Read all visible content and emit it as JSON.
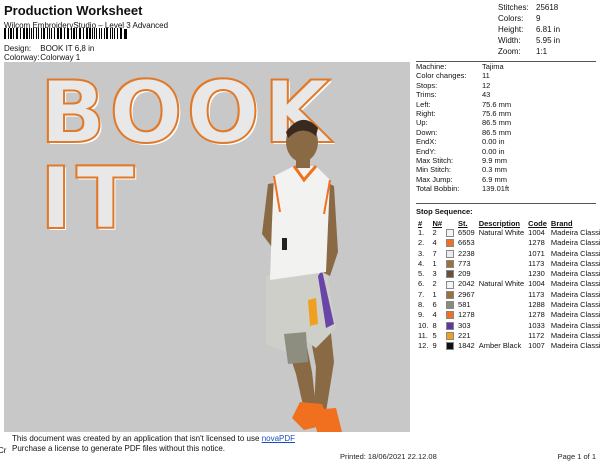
{
  "header": {
    "title": "Production Worksheet",
    "software": "Wilcom EmbroideryStudio – Level 3 Advanced",
    "design_label": "Design:",
    "design_value": "BOOK IT 6,8 in",
    "colorway_label": "Colorway:",
    "colorway_value": "Colorway 1"
  },
  "stats": [
    {
      "label": "Stitches:",
      "value": "25618"
    },
    {
      "label": "Colors:",
      "value": "9"
    },
    {
      "label": "Height:",
      "value": "6.81 in"
    },
    {
      "label": "Width:",
      "value": "5.95 in"
    },
    {
      "label": "Zoom:",
      "value": "1:1"
    }
  ],
  "design": {
    "text": "BOOK IT",
    "colors": {
      "bg": "#c8c8c8",
      "outline": "#e07a2a",
      "letter": "#e8e8e8"
    }
  },
  "machine_info": [
    {
      "label": "Machine:",
      "value": "Tajima"
    },
    {
      "label": "Color changes:",
      "value": "11"
    },
    {
      "label": "Stops:",
      "value": "12"
    },
    {
      "label": "Trims:",
      "value": "43"
    },
    {
      "label": "Left:",
      "value": "75.6 mm"
    },
    {
      "label": "Right:",
      "value": "75.6 mm"
    },
    {
      "label": "Up:",
      "value": "86.5 mm"
    },
    {
      "label": "Down:",
      "value": "86.5 mm"
    },
    {
      "label": "EndX:",
      "value": "0.00 in"
    },
    {
      "label": "EndY:",
      "value": "0.00 in"
    },
    {
      "label": "Max Stitch:",
      "value": "9.9 mm"
    },
    {
      "label": "Min Stitch:",
      "value": "0.3 mm"
    },
    {
      "label": "Max Jump:",
      "value": "6.9 mm"
    },
    {
      "label": "Total Bobbin:",
      "value": "139.01ft"
    }
  ],
  "stop_sequence": {
    "heading": "Stop Sequence:",
    "columns": [
      "#",
      "N#",
      "St.",
      "Description",
      "Code",
      "Brand"
    ],
    "rows": [
      {
        "stop": "1.",
        "needle": "2",
        "color": "#f4f4f4",
        "st": "6509",
        "desc": "Natural White",
        "code": "1004",
        "brand": "Madeira Classic 40"
      },
      {
        "stop": "2.",
        "needle": "4",
        "color": "#f07020",
        "st": "6653",
        "desc": "",
        "code": "1278",
        "brand": "Madeira Classic 40"
      },
      {
        "stop": "3.",
        "needle": "7",
        "color": "#ececec",
        "st": "2238",
        "desc": "",
        "code": "1071",
        "brand": "Madeira Classic 40"
      },
      {
        "stop": "4.",
        "needle": "1",
        "color": "#9a7040",
        "st": "773",
        "desc": "",
        "code": "1173",
        "brand": "Madeira Classic 40"
      },
      {
        "stop": "5.",
        "needle": "3",
        "color": "#6a5038",
        "st": "209",
        "desc": "",
        "code": "1230",
        "brand": "Madeira Classic 40"
      },
      {
        "stop": "6.",
        "needle": "2",
        "color": "#f4f4f4",
        "st": "2042",
        "desc": "Natural White",
        "code": "1004",
        "brand": "Madeira Classic 40"
      },
      {
        "stop": "7.",
        "needle": "1",
        "color": "#9a7040",
        "st": "2967",
        "desc": "",
        "code": "1173",
        "brand": "Madeira Classic 40"
      },
      {
        "stop": "8.",
        "needle": "6",
        "color": "#8a8a7a",
        "st": "581",
        "desc": "",
        "code": "1288",
        "brand": "Madeira Classic 40"
      },
      {
        "stop": "9.",
        "needle": "4",
        "color": "#f07020",
        "st": "1278",
        "desc": "",
        "code": "1278",
        "brand": "Madeira Classic 40"
      },
      {
        "stop": "10.",
        "needle": "8",
        "color": "#5a3aa0",
        "st": "303",
        "desc": "",
        "code": "1033",
        "brand": "Madeira Classic 40"
      },
      {
        "stop": "11.",
        "needle": "5",
        "color": "#f0a020",
        "st": "221",
        "desc": "",
        "code": "1172",
        "brand": "Madeira Classic 40"
      },
      {
        "stop": "12.",
        "needle": "9",
        "color": "#101010",
        "st": "1842",
        "desc": "Amber Black",
        "code": "1007",
        "brand": "Madeira Classic 40"
      }
    ]
  },
  "notice": {
    "line1_prefix": "This document was created by an application that isn't licensed to use",
    "link": "novaPDF",
    "line2": "Purchase a license to generate PDF files without this notice.",
    "corner": "Cr"
  },
  "footer": {
    "printed": "Printed: 18/06/2021 22.12.08",
    "page": "Page 1 of 1"
  }
}
